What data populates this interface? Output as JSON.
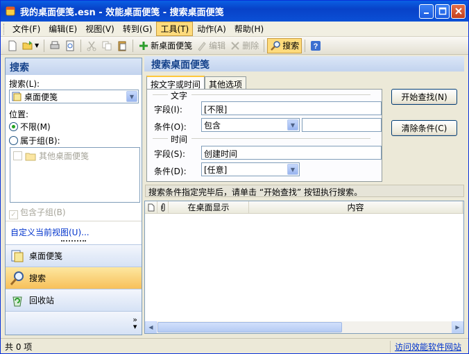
{
  "window": {
    "title": "我的桌面便笺.esn - 效能桌面便笺 - 搜索桌面便笺",
    "accent_color": "#0a50d6"
  },
  "menu": [
    {
      "label": "文件(F)"
    },
    {
      "label": "编辑(E)"
    },
    {
      "label": "视图(V)"
    },
    {
      "label": "转到(G)"
    },
    {
      "label": "工具(T)"
    },
    {
      "label": "动作(A)"
    },
    {
      "label": "帮助(H)"
    }
  ],
  "toolbar": {
    "new_label": "新桌面便笺",
    "edit_label": "编辑",
    "delete_label": "删除",
    "search_label": "搜索"
  },
  "left": {
    "header": "搜索",
    "search_label": "搜索(L):",
    "search_value": "桌面便笺",
    "location_label": "位置:",
    "radio_any": "不限(M)",
    "radio_group": "属于组(B):",
    "group_item": "其他桌面便笺",
    "include_sub": "包含子组(B)",
    "custom_view": "自定义当前视图(U)...",
    "nav": [
      {
        "label": "桌面便笺"
      },
      {
        "label": "搜索"
      },
      {
        "label": "回收站"
      }
    ]
  },
  "right": {
    "header": "搜索桌面便笺",
    "tabs": [
      {
        "label": "按文字或时间"
      },
      {
        "label": "其他选项"
      }
    ],
    "text_section": "文字",
    "text_field_label": "字段(I):",
    "text_field_value": "[不限]",
    "text_cond_label": "条件(O):",
    "text_cond_value": "包含",
    "text_input_value": "",
    "time_section": "时间",
    "time_field_label": "字段(S):",
    "time_field_value": "创建时间",
    "time_cond_label": "条件(D):",
    "time_cond_value": "[任意]",
    "start_button": "开始查找(N)",
    "clear_button": "清除条件(C)",
    "hint": "搜索条件指定完毕后，请单击 “开始查找” 按钮执行搜索。",
    "columns": [
      {
        "label": ""
      },
      {
        "label": ""
      },
      {
        "label": "在桌面显示"
      },
      {
        "label": "内容"
      }
    ]
  },
  "status": {
    "count": "共 0 项",
    "link": "访问效能软件网站"
  }
}
